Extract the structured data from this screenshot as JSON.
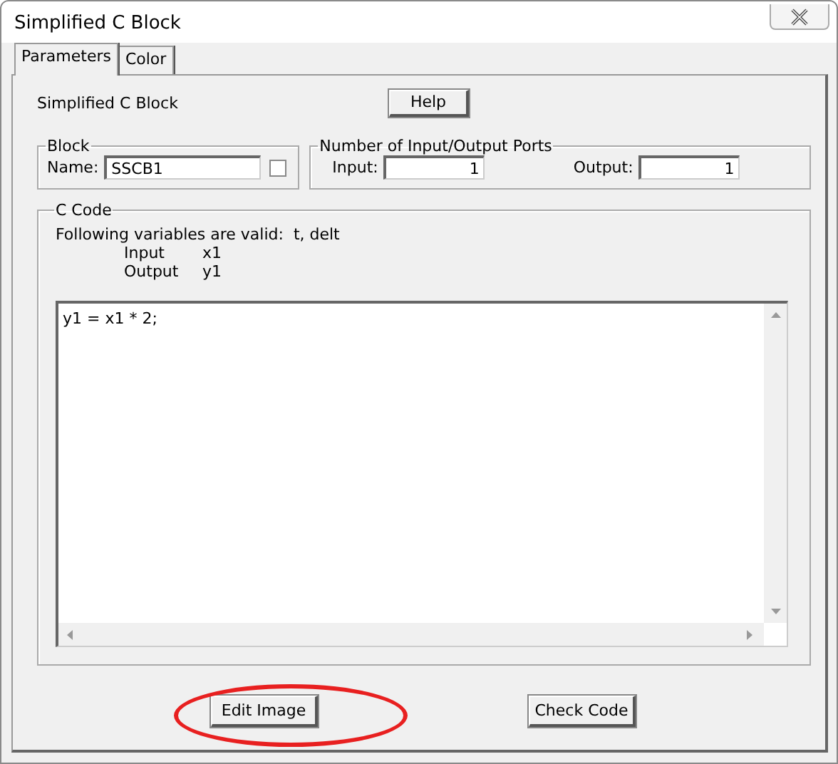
{
  "window": {
    "title": "Simplified C Block"
  },
  "tabs": [
    {
      "label": "Parameters",
      "selected": true
    },
    {
      "label": "Color",
      "selected": false
    }
  ],
  "description": "Simplified C Block",
  "help_button": "Help",
  "block_group": {
    "title": "Block",
    "name_label": "Name:",
    "name_value": "SSCB1",
    "checked": false
  },
  "ports_group": {
    "title": "Number of Input/Output Ports",
    "input_label": "Input:",
    "input_value": "1",
    "output_label": "Output:",
    "output_value": "1"
  },
  "code_group": {
    "title": "C Code",
    "hint": "Following variables are valid:  t, delt",
    "variables": [
      {
        "label": "Input",
        "value": "x1"
      },
      {
        "label": "Output",
        "value": "y1"
      }
    ],
    "code": "y1 = x1 * 2;"
  },
  "buttons": [
    "Edit Image",
    "Check Code"
  ]
}
